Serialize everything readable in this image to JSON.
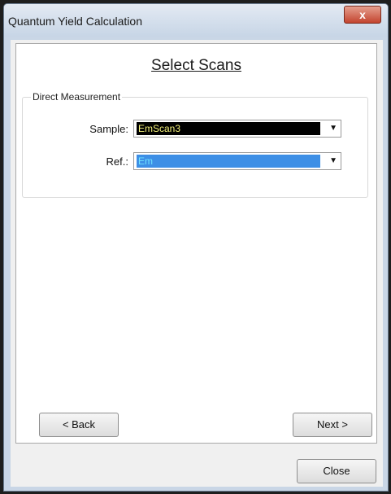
{
  "window": {
    "title": "Quantum Yield Calculation",
    "close_glyph": "x"
  },
  "page": {
    "heading": "Select Scans"
  },
  "group": {
    "label": "Direct Measurement"
  },
  "sample": {
    "label": "Sample:",
    "value": "EmScan3"
  },
  "ref": {
    "label": "Ref.:",
    "value": "Em"
  },
  "buttons": {
    "back": "< Back",
    "next": "Next >",
    "close": "Close"
  },
  "colors": {
    "sample_bg": "#000000",
    "sample_text": "#f4f27a",
    "ref_bg": "#3d8fe6",
    "ref_text": "#6fe3ff"
  }
}
